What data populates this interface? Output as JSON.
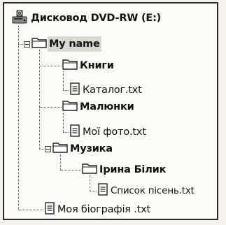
{
  "tree": {
    "root": {
      "label": "Дисковод DVD-RW (E:)",
      "icon": "dvd-drive-icon"
    },
    "my_name": {
      "label": "My name",
      "icon": "folder-icon"
    },
    "knyhy": {
      "label": "Книги",
      "icon": "folder-icon"
    },
    "katalog": {
      "label": "Каталог.txt",
      "icon": "text-file-icon"
    },
    "malyunky": {
      "label": "Малюнки",
      "icon": "folder-icon"
    },
    "moi_foto": {
      "label": "Мої фото.txt",
      "icon": "text-file-icon"
    },
    "muzyka": {
      "label": "Музика",
      "icon": "folder-icon"
    },
    "iryna_bilyk": {
      "label": "Ірина Білик",
      "icon": "folder-icon"
    },
    "spysok_pisen": {
      "label": "Список пісень.txt",
      "icon": "text-file-icon"
    },
    "moya_biohrafiya": {
      "label": "Моя біографія .txt",
      "icon": "text-file-icon"
    }
  }
}
